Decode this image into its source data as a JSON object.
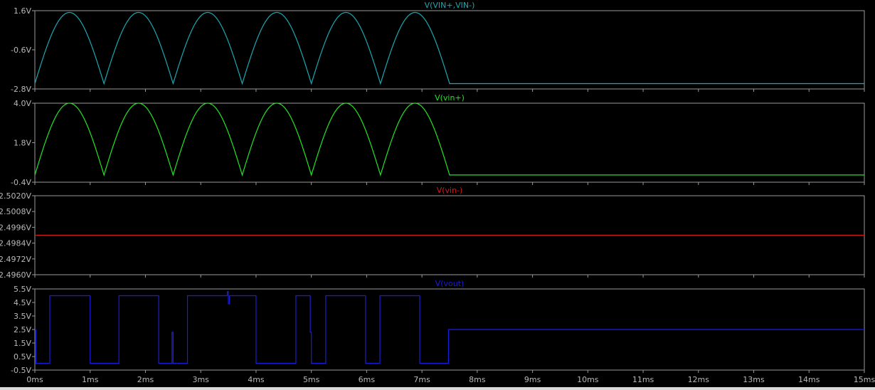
{
  "window": {
    "background": "#000000",
    "frame_color": "#9a9a9a",
    "tick_text_color": "#b8b8b8"
  },
  "chart_data": [
    {
      "type": "line",
      "title": "V(VIN+,VIN-)",
      "color": "#1aa8b4",
      "ylim": [
        -2.8,
        1.6
      ],
      "yticks": [
        "1.6V",
        "-0.6V",
        "-2.8V"
      ],
      "yticks_values": [
        1.6,
        -0.6,
        -2.8
      ],
      "xlim": [
        0,
        15
      ],
      "waveform": {
        "kind": "full-wave-rectified",
        "period_ms": 1.25,
        "min": -2.5,
        "max": 1.5,
        "end_ms": 7.5,
        "after_value": -2.5
      },
      "series": [
        {
          "name": "V(VIN+,VIN-)",
          "values": []
        }
      ]
    },
    {
      "type": "line",
      "title": "V(vin+)",
      "color": "#22e622",
      "ylim": [
        -0.4,
        4.0
      ],
      "yticks": [
        "4.0V",
        "1.8V",
        "-0.4V"
      ],
      "yticks_values": [
        4.0,
        1.8,
        -0.4
      ],
      "xlim": [
        0,
        15
      ],
      "waveform": {
        "kind": "full-wave-rectified",
        "period_ms": 1.25,
        "min": 0.0,
        "max": 4.0,
        "end_ms": 7.5,
        "after_value": 0.0
      },
      "series": [
        {
          "name": "V(vin+)",
          "values": []
        }
      ]
    },
    {
      "type": "line",
      "title": "V(vin-)",
      "color": "#d21c1c",
      "ylim": [
        2.496,
        2.502
      ],
      "yticks": [
        "2.5020V",
        "2.5008V",
        "2.4996V",
        "2.4984V",
        "2.4972V",
        "2.4960V"
      ],
      "yticks_values": [
        2.502,
        2.5008,
        2.4996,
        2.4984,
        2.4972,
        2.496
      ],
      "xlim": [
        0,
        15
      ],
      "series": [
        {
          "name": "V(vin-)",
          "x": [
            0,
            15
          ],
          "y": [
            2.499,
            2.499
          ]
        }
      ]
    },
    {
      "type": "line",
      "title": "V(vout)",
      "color": "#1c1cdc",
      "ylim": [
        -0.5,
        5.5
      ],
      "yticks": [
        "5.5V",
        "4.5V",
        "3.5V",
        "2.5V",
        "1.5V",
        "0.5V",
        "-0.5V"
      ],
      "yticks_values": [
        5.5,
        4.5,
        3.5,
        2.5,
        1.5,
        0.5,
        -0.5
      ],
      "xlim": [
        0,
        15
      ],
      "xticks": [
        "0ms",
        "1ms",
        "2ms",
        "3ms",
        "4ms",
        "5ms",
        "6ms",
        "7ms",
        "8ms",
        "9ms",
        "10ms",
        "11ms",
        "12ms",
        "13ms",
        "14ms",
        "15ms"
      ],
      "xticks_values": [
        0,
        1,
        2,
        3,
        4,
        5,
        6,
        7,
        8,
        9,
        10,
        11,
        12,
        13,
        14,
        15
      ],
      "series": [
        {
          "name": "V(vout)",
          "x": [
            0,
            0.02,
            0.02,
            0.05,
            0.05,
            0.27,
            0.27,
            0.3,
            0.3,
            1.0,
            1.0,
            1.52,
            1.52,
            2.24,
            2.24,
            2.48,
            2.48,
            2.5,
            2.5,
            2.52,
            2.52,
            2.76,
            2.76,
            3.48,
            3.48,
            3.5,
            3.5,
            3.52,
            3.52,
            4.0,
            4.0,
            4.72,
            4.72,
            4.98,
            4.98,
            5.0,
            5.0,
            5.26,
            5.26,
            5.98,
            5.98,
            6.24,
            6.24,
            6.96,
            6.96,
            7.22,
            7.22,
            7.48,
            7.48,
            7.52,
            7.52,
            15.0
          ],
          "y": [
            2.5,
            2.5,
            0.0,
            0.0,
            0.0,
            0.0,
            5.0,
            5.0,
            5.0,
            5.0,
            0.0,
            0.0,
            5.0,
            5.0,
            0.0,
            0.0,
            2.3,
            2.3,
            0.0,
            0.0,
            0.0,
            0.0,
            5.0,
            5.0,
            5.3,
            5.3,
            4.4,
            4.4,
            5.0,
            5.0,
            0.0,
            0.0,
            5.0,
            5.0,
            2.3,
            2.3,
            0.0,
            0.0,
            5.0,
            5.0,
            0.0,
            0.0,
            5.0,
            5.0,
            0.0,
            0.0,
            0.0,
            0.0,
            2.5,
            2.5,
            2.5,
            2.5
          ]
        }
      ]
    }
  ]
}
